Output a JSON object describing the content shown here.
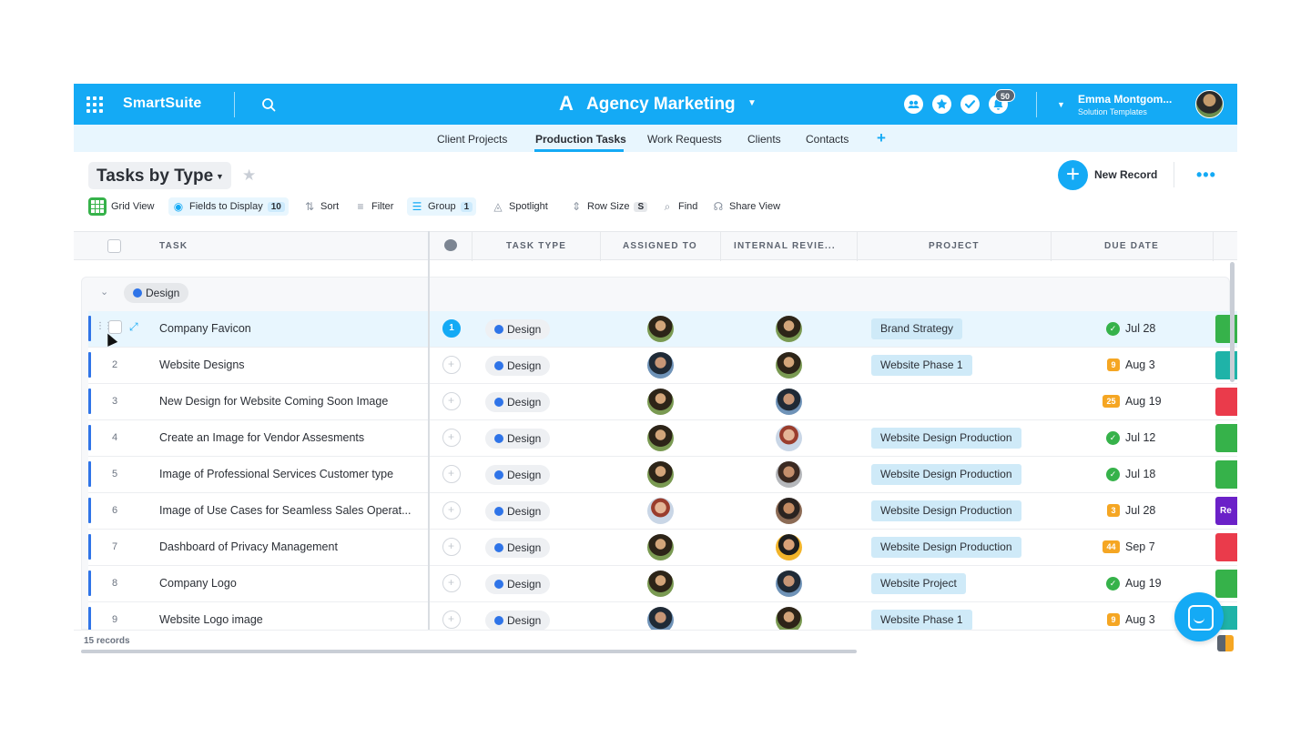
{
  "app": {
    "brand": "SmartSuite",
    "workspace_logo": "A",
    "workspace_title": "Agency Marketing",
    "notifications_count": "50",
    "user_name": "Emma Montgom...",
    "user_subtitle": "Solution Templates"
  },
  "tabs": [
    {
      "label": "Client Projects",
      "active": false
    },
    {
      "label": "Production Tasks",
      "active": true
    },
    {
      "label": "Work Requests",
      "active": false
    },
    {
      "label": "Clients",
      "active": false
    },
    {
      "label": "Contacts",
      "active": false
    }
  ],
  "view": {
    "title": "Tasks by Type",
    "new_record_label": "New Record"
  },
  "toolbar": {
    "grid_view": "Grid View",
    "fields": "Fields to Display",
    "fields_count": "10",
    "sort": "Sort",
    "filter": "Filter",
    "group": "Group",
    "group_count": "1",
    "spotlight": "Spotlight",
    "row_size": "Row Size",
    "row_size_value": "S",
    "find": "Find",
    "share": "Share View"
  },
  "columns": {
    "task": "TASK",
    "task_type": "TASK TYPE",
    "assigned_to": "ASSIGNED TO",
    "internal_review": "INTERNAL REVIE...",
    "project": "PROJECT",
    "due_date": "DUE DATE"
  },
  "group": {
    "label": "Design"
  },
  "rows": [
    {
      "num": "1",
      "title": "Company Favicon",
      "comments": "1",
      "type": "Design",
      "assigned": "a1",
      "reviewer": "a1",
      "project": "Brand Strategy",
      "due_kind": "done",
      "due_badge": "",
      "due": "Jul 28",
      "status_color": "#36b24a",
      "status_text": ""
    },
    {
      "num": "2",
      "title": "Website Designs",
      "comments": "",
      "type": "Design",
      "assigned": "a2",
      "reviewer": "a1",
      "project": "Website Phase 1",
      "due_kind": "badge",
      "due_badge": "9",
      "due": "Aug 3",
      "status_color": "#1fb3a8",
      "status_text": ""
    },
    {
      "num": "3",
      "title": "New Design for Website Coming Soon Image",
      "comments": "",
      "type": "Design",
      "assigned": "a1",
      "reviewer": "a2",
      "project": "",
      "due_kind": "badge",
      "due_badge": "25",
      "due": "Aug 19",
      "status_color": "#ea3b4b",
      "status_text": ""
    },
    {
      "num": "4",
      "title": "Create an Image for Vendor Assesments",
      "comments": "",
      "type": "Design",
      "assigned": "a1",
      "reviewer": "a3",
      "project": "Website Design Production",
      "due_kind": "done",
      "due_badge": "",
      "due": "Jul 12",
      "status_color": "#36b24a",
      "status_text": ""
    },
    {
      "num": "5",
      "title": "Image of Professional Services Customer type",
      "comments": "",
      "type": "Design",
      "assigned": "a1",
      "reviewer": "a4",
      "project": "Website Design Production",
      "due_kind": "done",
      "due_badge": "",
      "due": "Jul 18",
      "status_color": "#36b24a",
      "status_text": ""
    },
    {
      "num": "6",
      "title": "Image of Use Cases for Seamless Sales Operat...",
      "comments": "",
      "type": "Design",
      "assigned": "a3",
      "reviewer": "a5",
      "project": "Website Design Production",
      "due_kind": "badge",
      "due_badge": "3",
      "due": "Jul 28",
      "status_color": "#6b21c8",
      "status_text": "Re"
    },
    {
      "num": "7",
      "title": "Dashboard of Privacy Management",
      "comments": "",
      "type": "Design",
      "assigned": "a1",
      "reviewer": "a6",
      "project": "Website Design Production",
      "due_kind": "badge",
      "due_badge": "44",
      "due": "Sep 7",
      "status_color": "#ea3b4b",
      "status_text": ""
    },
    {
      "num": "8",
      "title": "Company Logo",
      "comments": "",
      "type": "Design",
      "assigned": "a1",
      "reviewer": "a2",
      "project": "Website Project",
      "due_kind": "done",
      "due_badge": "",
      "due": "Aug 19",
      "status_color": "#36b24a",
      "status_text": ""
    },
    {
      "num": "9",
      "title": "Website Logo image",
      "comments": "",
      "type": "Design",
      "assigned": "a2",
      "reviewer": "a1",
      "project": "Website Phase 1",
      "due_kind": "badge",
      "due_badge": "9",
      "due": "Aug 3",
      "status_color": "#1fb3a8",
      "status_text": ""
    }
  ],
  "footer": {
    "records": "15 records"
  },
  "colors": {
    "accent": "#14aaf5",
    "tab_bg": "#e8f6fe",
    "group_dot": "#2f74e8",
    "done": "#36b24a",
    "warn": "#f5a623"
  }
}
